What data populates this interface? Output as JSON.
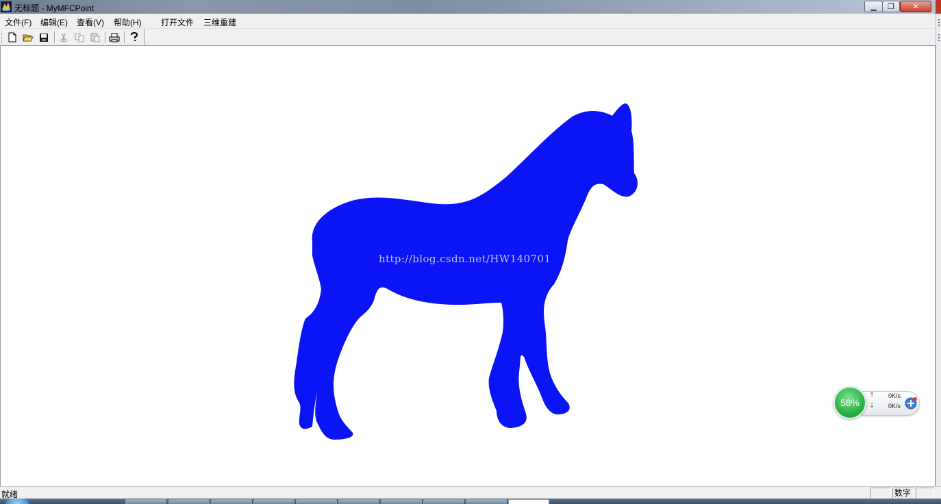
{
  "window": {
    "title": "无标题 - MyMFCPoint",
    "controls": {
      "minimize": "▁",
      "maximize": "❐",
      "close": "✕"
    }
  },
  "menubar": {
    "items": [
      "文件(F)",
      "编辑(E)",
      "查看(V)",
      "帮助(H)",
      "打开文件",
      "三维重建"
    ]
  },
  "toolbar": {
    "buttons": [
      "new-icon",
      "open-icon",
      "save-icon",
      "cut-icon",
      "copy-icon",
      "paste-icon",
      "print-icon",
      "help-icon"
    ]
  },
  "canvas": {
    "shape": "horse-silhouette",
    "fill_color": "#0a14f5",
    "watermark": "http://blog.csdn.net/HW140701"
  },
  "net_widget": {
    "percent": "58%",
    "upload": "0K/s",
    "download": "0K/s"
  },
  "statusbar": {
    "ready": "就绪",
    "num_indicator": "数字"
  },
  "colors": {
    "horse": "#0a14f5",
    "chrome": "#f0f0f0",
    "close_button": "#c6402d"
  }
}
